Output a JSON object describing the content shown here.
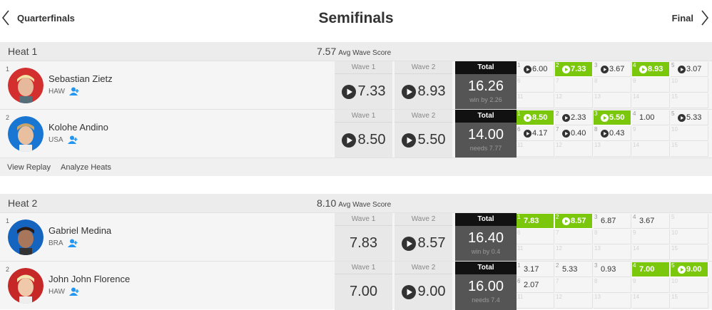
{
  "nav": {
    "prev_label": "Quarterfinals",
    "title": "Semifinals",
    "next_label": "Final"
  },
  "labels": {
    "wave1": "Wave 1",
    "wave2": "Wave 2",
    "total": "Total",
    "avg_suffix": "Avg Wave Score"
  },
  "colors": {
    "green": "#7ac70c",
    "total_dark": "#111111",
    "total_bg": "#555555",
    "follow_blue": "#2196f3"
  },
  "footer": {
    "view_replay": "View Replay",
    "analyze_heats": "Analyze Heats"
  },
  "heats": [
    {
      "title": "Heat 1",
      "avg": "7.57",
      "surfers": [
        {
          "seed": "1",
          "name": "Sebastian Zietz",
          "country": "HAW",
          "avatar": "#d32f2f",
          "wave1": {
            "v": "7.33",
            "play": true
          },
          "wave2": {
            "v": "8.93",
            "play": true
          },
          "total": "16.26",
          "note": "win by 2.26",
          "waves": [
            {
              "n": "1",
              "v": "6.00",
              "play": true,
              "green": false
            },
            {
              "n": "2",
              "v": "7.33",
              "play": true,
              "green": true
            },
            {
              "n": "3",
              "v": "3.67",
              "play": true,
              "green": false
            },
            {
              "n": "4",
              "v": "8.93",
              "play": true,
              "green": true
            },
            {
              "n": "5",
              "v": "3.07",
              "play": true,
              "green": false
            }
          ],
          "empty": [
            "6",
            "7",
            "8",
            "9",
            "10",
            "11",
            "12",
            "13",
            "14",
            "15"
          ]
        },
        {
          "seed": "2",
          "name": "Kolohe Andino",
          "country": "USA",
          "avatar": "#1976d2",
          "wave1": {
            "v": "8.50",
            "play": true
          },
          "wave2": {
            "v": "5.50",
            "play": true
          },
          "total": "14.00",
          "note": "needs 7.77",
          "waves": [
            {
              "n": "1",
              "v": "8.50",
              "play": true,
              "green": true
            },
            {
              "n": "2",
              "v": "2.33",
              "play": true,
              "green": false
            },
            {
              "n": "3",
              "v": "5.50",
              "play": true,
              "green": true
            },
            {
              "n": "4",
              "v": "1.00",
              "play": false,
              "green": false
            },
            {
              "n": "5",
              "v": "5.33",
              "play": true,
              "green": false
            },
            {
              "n": "6",
              "v": "4.17",
              "play": true,
              "green": false
            },
            {
              "n": "7",
              "v": "0.40",
              "play": true,
              "green": false
            },
            {
              "n": "8",
              "v": "0.43",
              "play": true,
              "green": false
            }
          ],
          "empty": [
            "9",
            "10",
            "11",
            "12",
            "13",
            "14",
            "15"
          ]
        }
      ]
    },
    {
      "title": "Heat 2",
      "avg": "8.10",
      "surfers": [
        {
          "seed": "1",
          "name": "Gabriel Medina",
          "country": "BRA",
          "avatar": "#1565c0",
          "wave1": {
            "v": "7.83",
            "play": false
          },
          "wave2": {
            "v": "8.57",
            "play": true
          },
          "total": "16.40",
          "note": "win by 0.4",
          "waves": [
            {
              "n": "1",
              "v": "7.83",
              "play": false,
              "green": true
            },
            {
              "n": "2",
              "v": "8.57",
              "play": true,
              "green": true
            },
            {
              "n": "3",
              "v": "6.87",
              "play": false,
              "green": false
            },
            {
              "n": "4",
              "v": "3.67",
              "play": false,
              "green": false
            }
          ],
          "empty": [
            "5",
            "6",
            "7",
            "8",
            "9",
            "10",
            "11",
            "12",
            "13",
            "14",
            "15"
          ]
        },
        {
          "seed": "2",
          "name": "John John Florence",
          "country": "HAW",
          "avatar": "#c62828",
          "wave1": {
            "v": "7.00",
            "play": false
          },
          "wave2": {
            "v": "9.00",
            "play": true
          },
          "total": "16.00",
          "note": "needs 7.4",
          "waves": [
            {
              "n": "1",
              "v": "3.17",
              "play": false,
              "green": false
            },
            {
              "n": "2",
              "v": "5.33",
              "play": false,
              "green": false
            },
            {
              "n": "3",
              "v": "0.93",
              "play": false,
              "green": false
            },
            {
              "n": "4",
              "v": "7.00",
              "play": false,
              "green": true
            },
            {
              "n": "5",
              "v": "9.00",
              "play": true,
              "green": true
            },
            {
              "n": "6",
              "v": "2.07",
              "play": false,
              "green": false
            }
          ],
          "empty": [
            "7",
            "8",
            "9",
            "10",
            "11",
            "12",
            "13",
            "14",
            "15"
          ]
        }
      ]
    }
  ]
}
